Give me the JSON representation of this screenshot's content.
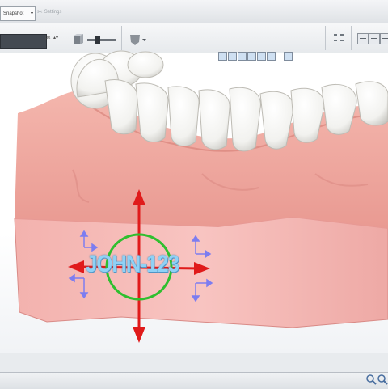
{
  "app": {
    "topbar": {
      "dropdown_value": "Snapshot",
      "settings_label": "Settings"
    },
    "toolbar": {
      "text_field_value": "",
      "unit_label": "px",
      "slider_level": 0.35
    }
  },
  "viewport": {
    "base_label_text": "JOHN-123",
    "manipulator": {
      "rotate_ring_color": "#2fbf2f",
      "vertical_axis_color": "#e01b1b",
      "horizontal_axis_color": "#e01b1b",
      "planar_handle_color": "#7d7df0"
    },
    "model_colors": {
      "gum": "#efa9a2",
      "base": "#f5b8b5",
      "teeth": "#f8f8f6"
    }
  },
  "icons": {
    "settings": "scissors-icon",
    "emboss": "emboss-icon",
    "shading": "shading-icon",
    "move": "move-tool-icon",
    "zoom_in": "zoom-in-icon",
    "zoom_out": "zoom-out-icon"
  }
}
